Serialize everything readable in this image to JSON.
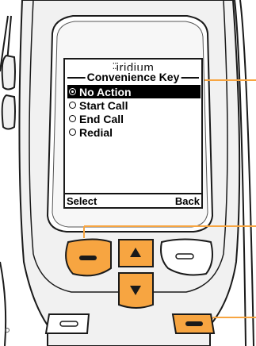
{
  "screen": {
    "brand": "iridium",
    "menu_title": "Convenience Key",
    "options": [
      {
        "label": "No Action",
        "selected": true
      },
      {
        "label": "Start Call",
        "selected": false
      },
      {
        "label": "End Call",
        "selected": false
      },
      {
        "label": "Redial",
        "selected": false
      }
    ],
    "softkeys": {
      "left": "Select",
      "right": "Back"
    }
  },
  "colors": {
    "accent_orange": "#F7A541",
    "callout_line": "#F7A541",
    "phone_body": "#F0F0F0",
    "outline": "#1A1A1A"
  },
  "icons": {
    "nav_up": "triangle-up-icon",
    "nav_down": "triangle-down-icon",
    "softkey_dash": "dash-icon"
  }
}
